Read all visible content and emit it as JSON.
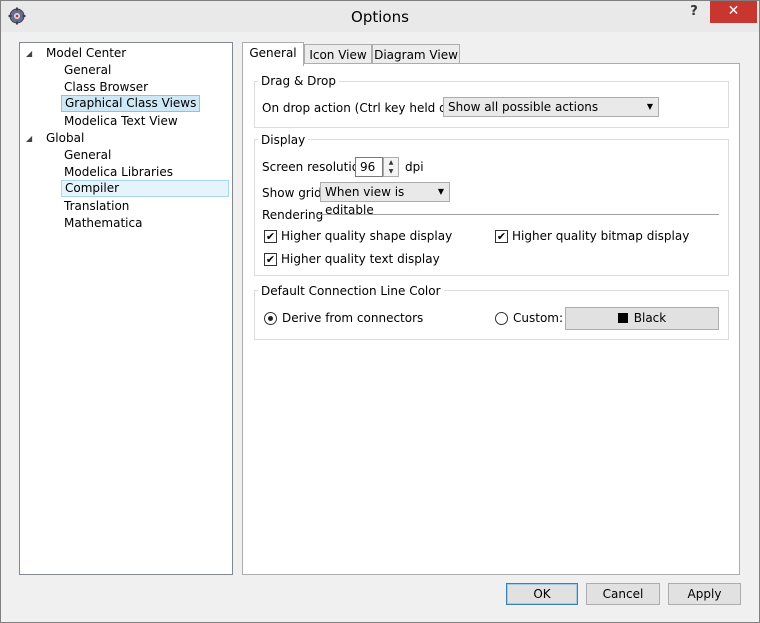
{
  "window": {
    "title": "Options",
    "help_glyph": "?",
    "close_glyph": "✕",
    "icon": "gear-icon"
  },
  "tree": {
    "items": [
      {
        "label": "Model Center",
        "level": 0,
        "expanded": true
      },
      {
        "label": "General",
        "level": 1
      },
      {
        "label": "Class Browser",
        "level": 1
      },
      {
        "label": "Graphical Class Views",
        "level": 1,
        "selected": true
      },
      {
        "label": "Modelica Text View",
        "level": 1
      },
      {
        "label": "Global",
        "level": 0,
        "expanded": true
      },
      {
        "label": "General",
        "level": 1
      },
      {
        "label": "Modelica Libraries",
        "level": 1
      },
      {
        "label": "Compiler",
        "level": 1,
        "highlighted": true
      },
      {
        "label": "Translation",
        "level": 1
      },
      {
        "label": "Mathematica",
        "level": 1
      }
    ],
    "expand_glyph": "◢"
  },
  "tabs": [
    {
      "label": "General",
      "active": true
    },
    {
      "label": "Icon View",
      "active": false
    },
    {
      "label": "Diagram View",
      "active": false
    }
  ],
  "drag_drop": {
    "title": "Drag & Drop",
    "on_drop_label": "On drop action (Ctrl key held down):",
    "on_drop_value": "Show all possible actions"
  },
  "display": {
    "title": "Display",
    "resolution_label": "Screen resolution:",
    "resolution_value": "96",
    "resolution_unit": "dpi",
    "grid_label": "Show grid:",
    "grid_value": "When view is editable",
    "rendering_title": "Rendering",
    "shape_label": "Higher quality shape display",
    "shape_checked": true,
    "bitmap_label": "Higher quality bitmap display",
    "bitmap_checked": true,
    "text_label": "Higher quality text display",
    "text_checked": true
  },
  "connection": {
    "title": "Default Connection Line Color",
    "derive_label": "Derive from connectors",
    "derive_selected": true,
    "custom_label": "Custom:",
    "custom_selected": false,
    "color_button_label": "Black",
    "color_value": "#000000"
  },
  "buttons": {
    "ok": "OK",
    "cancel": "Cancel",
    "apply": "Apply"
  },
  "glyphs": {
    "check": "✔",
    "dropdown": "▼",
    "spin_up": "▲",
    "spin_down": "▼"
  }
}
